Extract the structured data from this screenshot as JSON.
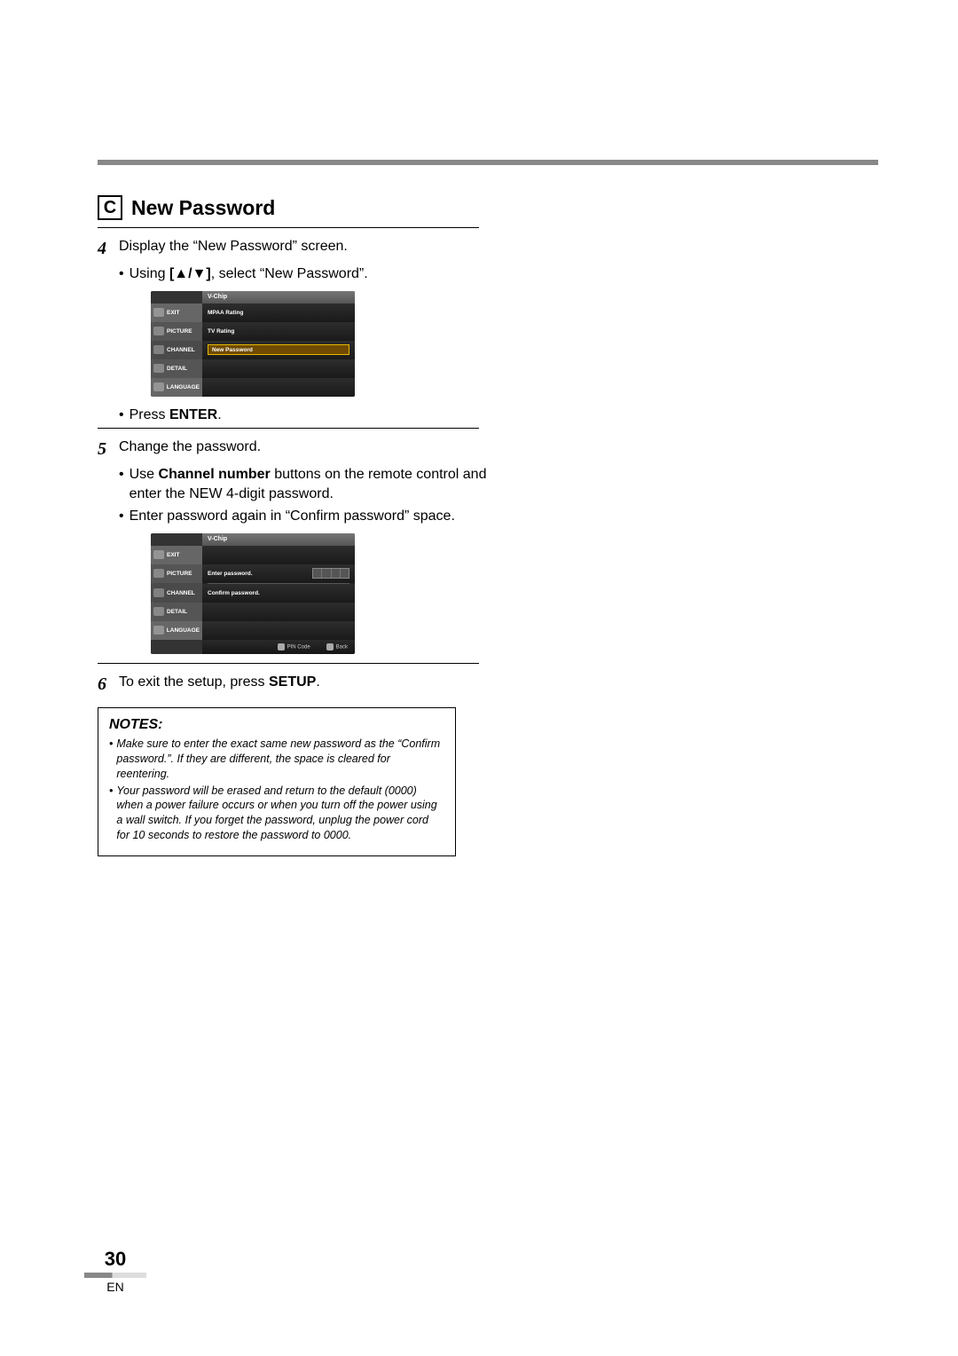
{
  "heading": {
    "letter": "C",
    "title": "New Password"
  },
  "steps": {
    "s4": {
      "num": "4",
      "text": "Display the “New Password” screen.",
      "sub1_pre": "Using ",
      "sub1_bold": "[▲/▼]",
      "sub1_post": ", select “New Password”.",
      "sub2_pre": "Press ",
      "sub2_bold": "ENTER",
      "sub2_post": "."
    },
    "s5": {
      "num": "5",
      "text": "Change the password.",
      "sub1_pre": "Use ",
      "sub1_bold": "Channel number",
      "sub1_post": " buttons on the remote control and enter the NEW 4-digit password.",
      "sub2": "Enter password again in “Confirm password” space."
    },
    "s6": {
      "num": "6",
      "pre": "To exit the setup, press ",
      "bold": "SETUP",
      "post": "."
    }
  },
  "osd1": {
    "title": "V-Chip",
    "left": [
      "EXIT",
      "PICTURE",
      "CHANNEL",
      "DETAIL",
      "LANGUAGE"
    ],
    "right": [
      "MPAA Rating",
      "TV Rating",
      "New Password"
    ]
  },
  "osd2": {
    "title": "V-Chip",
    "left": [
      "EXIT",
      "PICTURE",
      "CHANNEL",
      "DETAIL",
      "LANGUAGE"
    ],
    "enter": "Enter password.",
    "confirm": "Confirm password.",
    "footer": {
      "pin": "PIN Code",
      "back": "Back"
    }
  },
  "notes": {
    "title": "NOTES:",
    "items": [
      "Make sure to enter the exact same new password as the “Confirm password.”. If they are different, the space is cleared for reentering.",
      "Your password will be erased and return to the default (0000) when a power failure occurs or when you turn off the power using a wall switch. If you forget the password, unplug the power cord for 10 seconds to restore the password to 0000."
    ]
  },
  "footer": {
    "page": "30",
    "lang": "EN"
  }
}
